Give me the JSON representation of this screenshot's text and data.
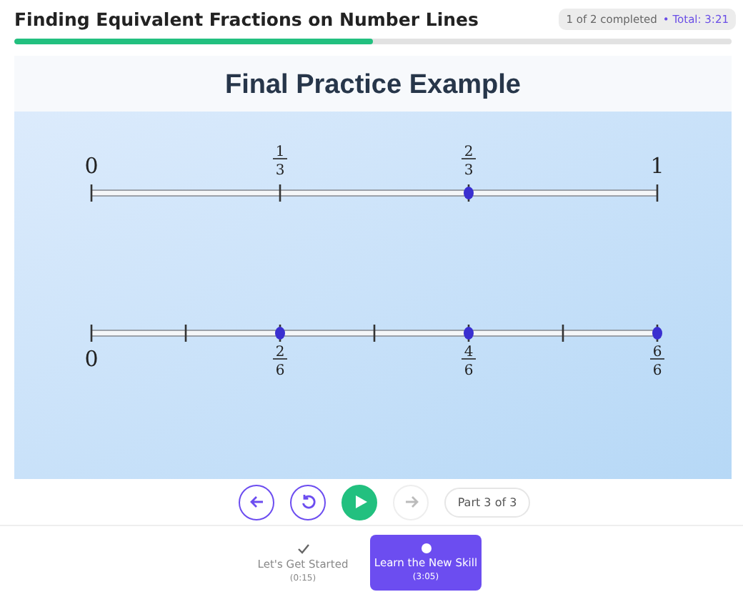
{
  "header": {
    "title": "Finding Equivalent Fractions on Number Lines",
    "completed": "1 of 2 completed",
    "total": "• Total: 3:21"
  },
  "progress": {
    "level": 0.5
  },
  "lesson": {
    "title": "Final Practice Example",
    "number_lines": [
      {
        "kind": "labels-above",
        "ticks": [
          {
            "kind": "tick",
            "label": "0"
          },
          {
            "kind": "tick",
            "numerator": "1",
            "denominator": "3"
          },
          {
            "kind": "point",
            "numerator": "2",
            "denominator": "3"
          },
          {
            "kind": "tick",
            "label": "1"
          }
        ]
      },
      {
        "kind": "labels-below",
        "ticks": [
          {
            "kind": "tick",
            "label": "0"
          },
          {
            "kind": "tick"
          },
          {
            "kind": "point",
            "numerator": "2",
            "denominator": "6"
          },
          {
            "kind": "tick"
          },
          {
            "kind": "point",
            "numerator": "4",
            "denominator": "6"
          },
          {
            "kind": "tick"
          },
          {
            "kind": "point",
            "numerator": "6",
            "denominator": "6"
          }
        ]
      }
    ]
  },
  "controls": [
    {
      "kind": "back",
      "disabled": false
    },
    {
      "kind": "restart",
      "disabled": false
    },
    {
      "kind": "play",
      "disabled": false
    },
    {
      "kind": "next",
      "disabled": true
    }
  ],
  "part": "Part 3 of 3",
  "steps": [
    {
      "label": "Let's Get Started",
      "time": "(0:15)",
      "completed": true,
      "selected": false
    },
    {
      "label": "Learn the New Skill",
      "time": "(3:05)",
      "completed": false,
      "selected": true
    }
  ]
}
